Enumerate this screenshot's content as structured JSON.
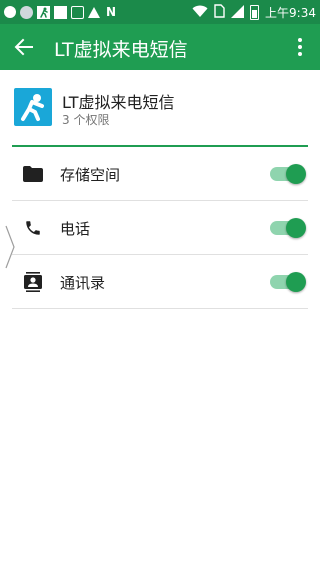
{
  "status_bar": {
    "left_icons": [
      "notification-dot-icon",
      "photo-icon",
      "runner-app-icon",
      "square-notification-icon",
      "sd-card-icon",
      "warning-icon",
      "n-logo-icon"
    ],
    "n_logo_text": "N",
    "right_icons": [
      "wifi-icon",
      "sim-card-icon",
      "signal-icon",
      "battery-icon"
    ],
    "time": "上午9:34"
  },
  "toolbar": {
    "back_icon": "arrow-back-icon",
    "title": "LT虚拟来电短信",
    "menu_icon": "more-vert-icon"
  },
  "app_header": {
    "app_name": "LT虚拟来电短信",
    "permission_count": "3 个权限"
  },
  "permissions": [
    {
      "label": "存储空间",
      "icon": "folder-icon",
      "enabled": true
    },
    {
      "label": "电话",
      "icon": "phone-icon",
      "enabled": true
    },
    {
      "label": "通讯录",
      "icon": "contacts-icon",
      "enabled": true
    }
  ],
  "colors": {
    "status_bar": "#1b8a4a",
    "toolbar": "#1f9d52",
    "accent": "#1f9d52",
    "toggle_track": "#8fd4ae",
    "app_icon": "#1aa7d8"
  }
}
